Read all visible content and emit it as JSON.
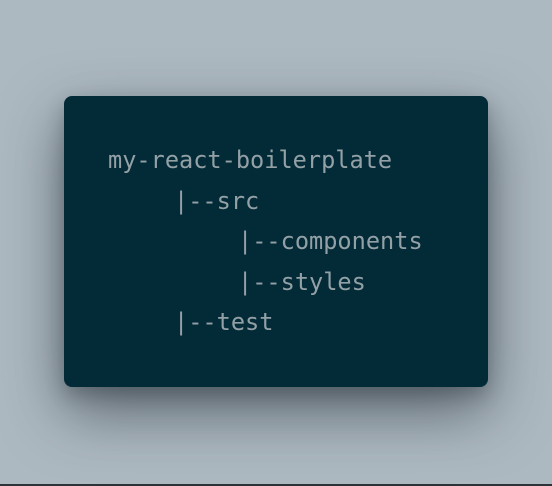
{
  "code_card": {
    "lines": [
      {
        "text": "my-react-boilerplate",
        "indent": 0
      },
      {
        "text": "|--src",
        "indent": 1
      },
      {
        "text": "|--components",
        "indent": 2
      },
      {
        "text": "|--styles",
        "indent": 2
      },
      {
        "text": "|--test",
        "indent": 1
      }
    ]
  },
  "colors": {
    "background": "#adb9c1",
    "card_background": "#022a37",
    "text": "#93a1a6"
  }
}
